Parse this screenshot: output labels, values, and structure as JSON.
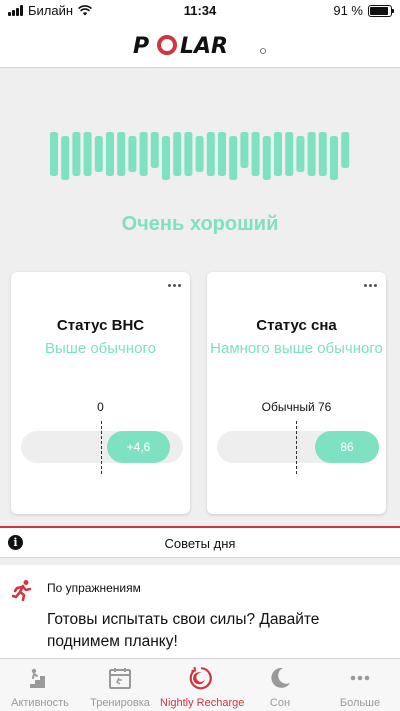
{
  "status_bar": {
    "carrier": "Билайн",
    "time": "11:34",
    "battery_percent": "91 %",
    "battery_level": 0.91
  },
  "header": {
    "brand": "POLAR"
  },
  "recharge": {
    "status": "Очень хороший",
    "accent_color": "#7ee1c2"
  },
  "cards": {
    "ans": {
      "title": "Статус ВНС",
      "status": "Выше обычного",
      "reference_label": "0",
      "value": "+4,6"
    },
    "sleep": {
      "title": "Статус сна",
      "status": "Намного выше обычного",
      "reference_label": "Обычный 76",
      "value": "86"
    }
  },
  "tips": {
    "bar_label": "Советы дня",
    "category": "По упражнениям",
    "text": "Готовы испытать свои силы? Давайте поднимем планку!"
  },
  "tabbar": {
    "active_color": "#d1363f",
    "tabs": [
      {
        "label": "Активность",
        "icon": "stairs-icon"
      },
      {
        "label": "Тренировка",
        "icon": "calendar-icon"
      },
      {
        "label": "Nightly Recharge",
        "icon": "recharge-icon"
      },
      {
        "label": "Сон",
        "icon": "moon-icon"
      },
      {
        "label": "Больше",
        "icon": "more-icon"
      }
    ]
  }
}
